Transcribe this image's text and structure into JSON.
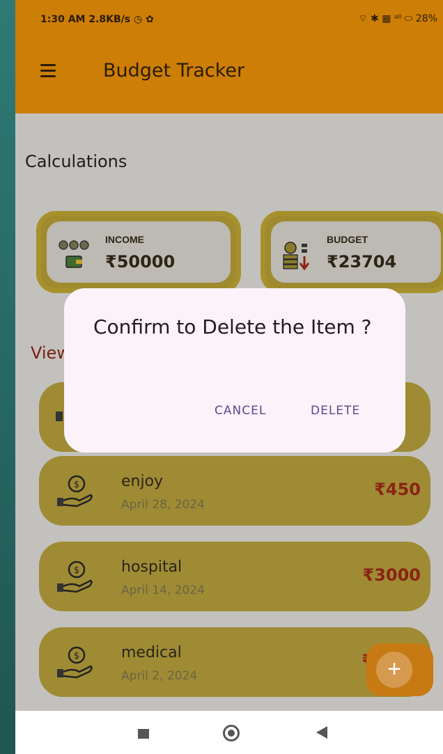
{
  "status_bar": {
    "left": "1:30 AM  2.8KB/s ◷ ✿",
    "right": "⌔ ✱ ▦ ᵃˡˡ ⬭ 28%"
  },
  "app_bar": {
    "title": "Budget Tracker"
  },
  "section": {
    "calculations": "Calculations",
    "view_label": "View"
  },
  "cards": {
    "income": {
      "label": "INCOME",
      "value": "₹50000"
    },
    "budget": {
      "label": "BUDGET",
      "value": "₹23704"
    }
  },
  "items": [
    {
      "name": "enjoy",
      "date": "April 28, 2024",
      "amount": "₹450"
    },
    {
      "name": "hospital",
      "date": "April 14, 2024",
      "amount": "₹3000"
    },
    {
      "name": "medical",
      "date": "April 2, 2024",
      "amount": "₹"
    }
  ],
  "fab": {
    "icon": "+"
  },
  "dialog": {
    "title": "Confirm to Delete the Item ?",
    "cancel": "CANCEL",
    "delete": "DELETE"
  },
  "colors": {
    "app_bar": "#cd7e06",
    "item_bg": "#9e8b34",
    "amount": "#8a2414",
    "dialog_button": "#5b4a8c"
  }
}
